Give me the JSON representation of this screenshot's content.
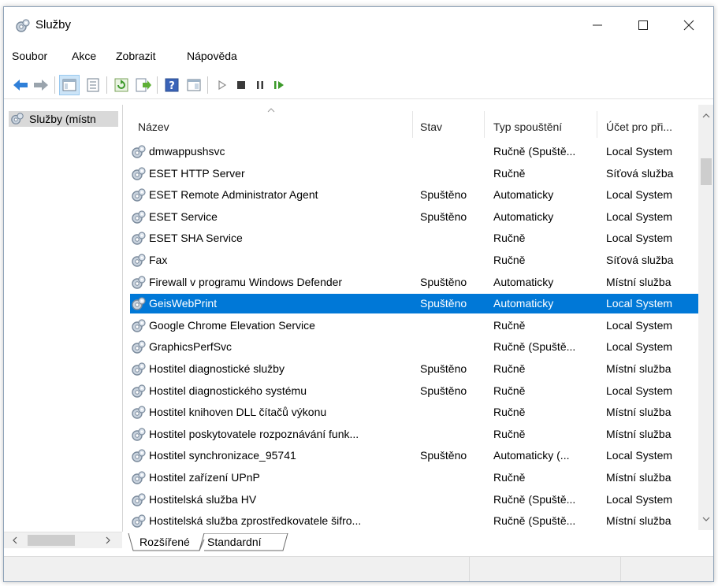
{
  "window": {
    "title": "Služby",
    "icon": "services-gear-icon"
  },
  "menu": {
    "items": [
      {
        "label": "Soubor"
      },
      {
        "label": "Akce"
      },
      {
        "label": "Zobrazit"
      },
      {
        "label": "Nápověda"
      }
    ]
  },
  "toolbar": {
    "icons": [
      "back-arrow-icon",
      "forward-arrow-icon",
      "console-tree-icon",
      "properties-icon",
      "refresh-icon",
      "export-list-icon",
      "help-icon",
      "show-hide-icon",
      "start-service-icon",
      "stop-service-icon",
      "pause-service-icon",
      "restart-service-icon"
    ]
  },
  "tree": {
    "root_label": "Služby (místn"
  },
  "table": {
    "headers": {
      "name": "Název",
      "status": "Stav",
      "startup": "Typ spouštění",
      "account": "Účet pro při..."
    },
    "rows": [
      {
        "name": "dmwappushsvc",
        "status": "",
        "startup": "Ručně (Spuště...",
        "account": "Local System"
      },
      {
        "name": "ESET HTTP Server",
        "status": "",
        "startup": "Ručně",
        "account": "Síťová služba"
      },
      {
        "name": "ESET Remote Administrator Agent",
        "status": "Spuštěno",
        "startup": "Automaticky",
        "account": "Local System"
      },
      {
        "name": "ESET Service",
        "status": "Spuštěno",
        "startup": "Automaticky",
        "account": "Local System"
      },
      {
        "name": "ESET SHA Service",
        "status": "",
        "startup": "Ručně",
        "account": "Local System"
      },
      {
        "name": "Fax",
        "status": "",
        "startup": "Ručně",
        "account": "Síťová služba"
      },
      {
        "name": "Firewall v programu Windows Defender",
        "status": "Spuštěno",
        "startup": "Automaticky",
        "account": "Místní služba"
      },
      {
        "name": "GeisWebPrint",
        "status": "Spuštěno",
        "startup": "Automaticky",
        "account": "Local System",
        "selected": true
      },
      {
        "name": "Google Chrome Elevation Service",
        "status": "",
        "startup": "Ručně",
        "account": "Local System"
      },
      {
        "name": "GraphicsPerfSvc",
        "status": "",
        "startup": "Ručně (Spuště...",
        "account": "Local System"
      },
      {
        "name": "Hostitel diagnostické služby",
        "status": "Spuštěno",
        "startup": "Ručně",
        "account": "Místní služba"
      },
      {
        "name": "Hostitel diagnostického systému",
        "status": "Spuštěno",
        "startup": "Ručně",
        "account": "Local System"
      },
      {
        "name": "Hostitel knihoven DLL čítačů výkonu",
        "status": "",
        "startup": "Ručně",
        "account": "Místní služba"
      },
      {
        "name": "Hostitel poskytovatele rozpoznávání funk...",
        "status": "",
        "startup": "Ručně",
        "account": "Místní služba"
      },
      {
        "name": "Hostitel synchronizace_95741",
        "status": "Spuštěno",
        "startup": "Automaticky (...",
        "account": "Local System"
      },
      {
        "name": "Hostitel zařízení UPnP",
        "status": "",
        "startup": "Ručně",
        "account": "Místní služba"
      },
      {
        "name": "Hostitelská služba HV",
        "status": "",
        "startup": "Ručně (Spuště...",
        "account": "Local System"
      },
      {
        "name": "Hostitelská služba zprostředkovatele šifro...",
        "status": "",
        "startup": "Ručně (Spuště...",
        "account": "Místní služba"
      }
    ]
  },
  "tabs": [
    {
      "label": "Rozšířené"
    },
    {
      "label": "Standardní",
      "active": true
    }
  ],
  "colors": {
    "selection": "#0078d7",
    "accent_blue": "#2f7fd8"
  }
}
